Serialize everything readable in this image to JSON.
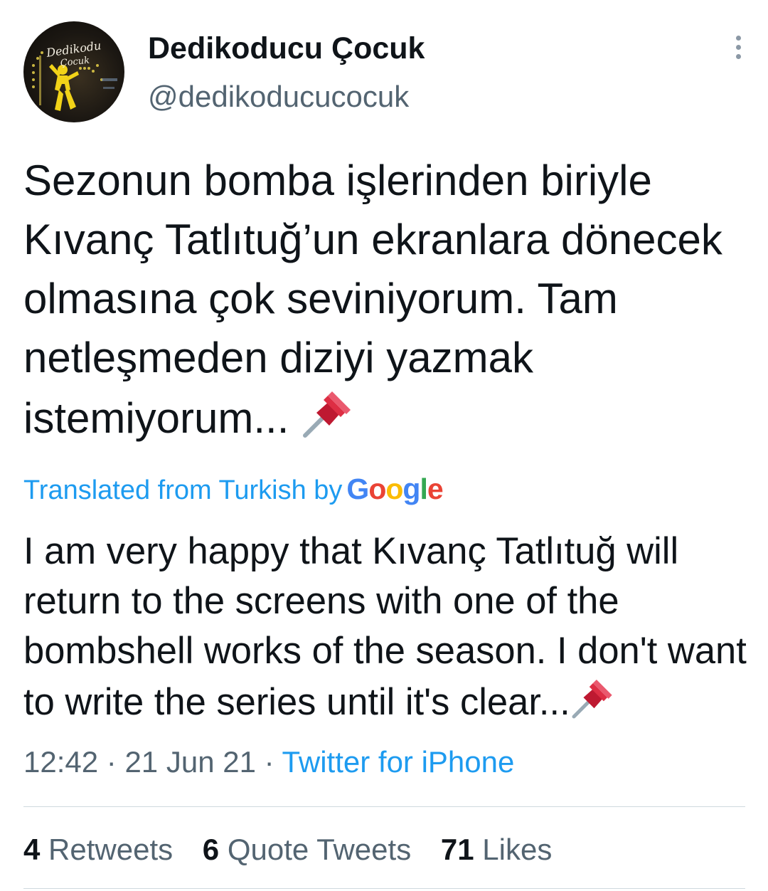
{
  "author": {
    "display_name": "Dedikoducu Çocuk",
    "handle": "@dedikoducucocuk",
    "avatar_text": "Dedikoducu Çocuk"
  },
  "tweet": {
    "text": "Sezonun bomba işlerinden biriyle Kıvanç Tatlıtuğ’un ekranlara dönecek olmasına çok seviniyorum. Tam netleşmeden diziyi yazmak istemiyorum...",
    "translated_label": "Translated from Turkish by",
    "google_letters": [
      "G",
      "o",
      "o",
      "g",
      "l",
      "e"
    ],
    "translation": "I am very happy that Kıvanç Tatlıtuğ will return to the screens with one of the bombshell works of the season. I don't want to write the series until it's clear...",
    "time": "12:42",
    "separator": "·",
    "date": "21 Jun 21",
    "source": "Twitter for iPhone",
    "emoji_icon": "pushpin-icon"
  },
  "stats": {
    "retweets_count": "4",
    "retweets_label": "Retweets",
    "quotes_count": "6",
    "quotes_label": "Quote Tweets",
    "likes_count": "71",
    "likes_label": "Likes"
  },
  "colors": {
    "text": "#0f1419",
    "secondary": "#536471",
    "link": "#1d9bf0",
    "divider": "#cfd9de",
    "google": [
      "#4285F4",
      "#EA4335",
      "#FBBC05",
      "#4285F4",
      "#34A853",
      "#EA4335"
    ]
  }
}
